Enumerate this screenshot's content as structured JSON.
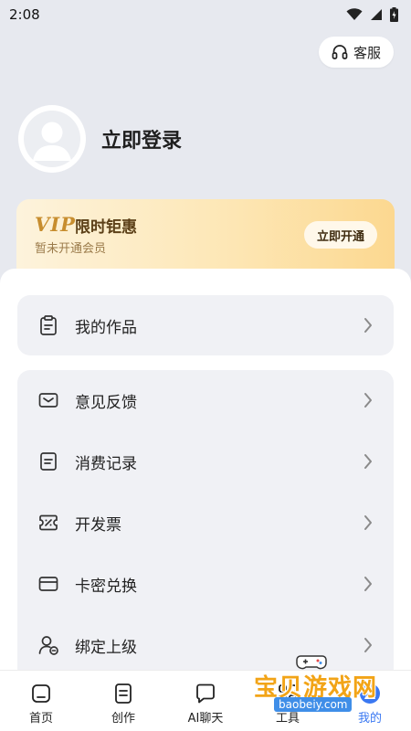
{
  "status_bar": {
    "time": "2:08"
  },
  "header": {
    "service_label": "客服"
  },
  "profile": {
    "login_label": "立即登录"
  },
  "vip": {
    "logo": "VIP",
    "title": "限时钜惠",
    "subtitle": "暂未开通会员",
    "button_label": "立即开通"
  },
  "menu_group_1": [
    {
      "label": "我的作品",
      "icon": "clipboard-icon"
    }
  ],
  "menu_group_2": [
    {
      "label": "意见反馈",
      "icon": "mail-icon"
    },
    {
      "label": "消费记录",
      "icon": "receipt-icon"
    },
    {
      "label": "开发票",
      "icon": "invoice-ticket-icon"
    },
    {
      "label": "卡密兑换",
      "icon": "card-icon"
    },
    {
      "label": "绑定上级",
      "icon": "user-link-icon"
    }
  ],
  "tabbar": {
    "items": [
      {
        "label": "首页",
        "icon": "home-icon"
      },
      {
        "label": "创作",
        "icon": "create-icon"
      },
      {
        "label": "AI聊天",
        "icon": "chat-icon"
      },
      {
        "label": "工具",
        "icon": "tools-icon"
      },
      {
        "label": "我的",
        "icon": "profile-icon"
      }
    ],
    "active_index": 4,
    "active_color": "#3a78f2"
  },
  "watermark": {
    "text": "宝贝游戏网",
    "url": "baobeiy.com"
  }
}
